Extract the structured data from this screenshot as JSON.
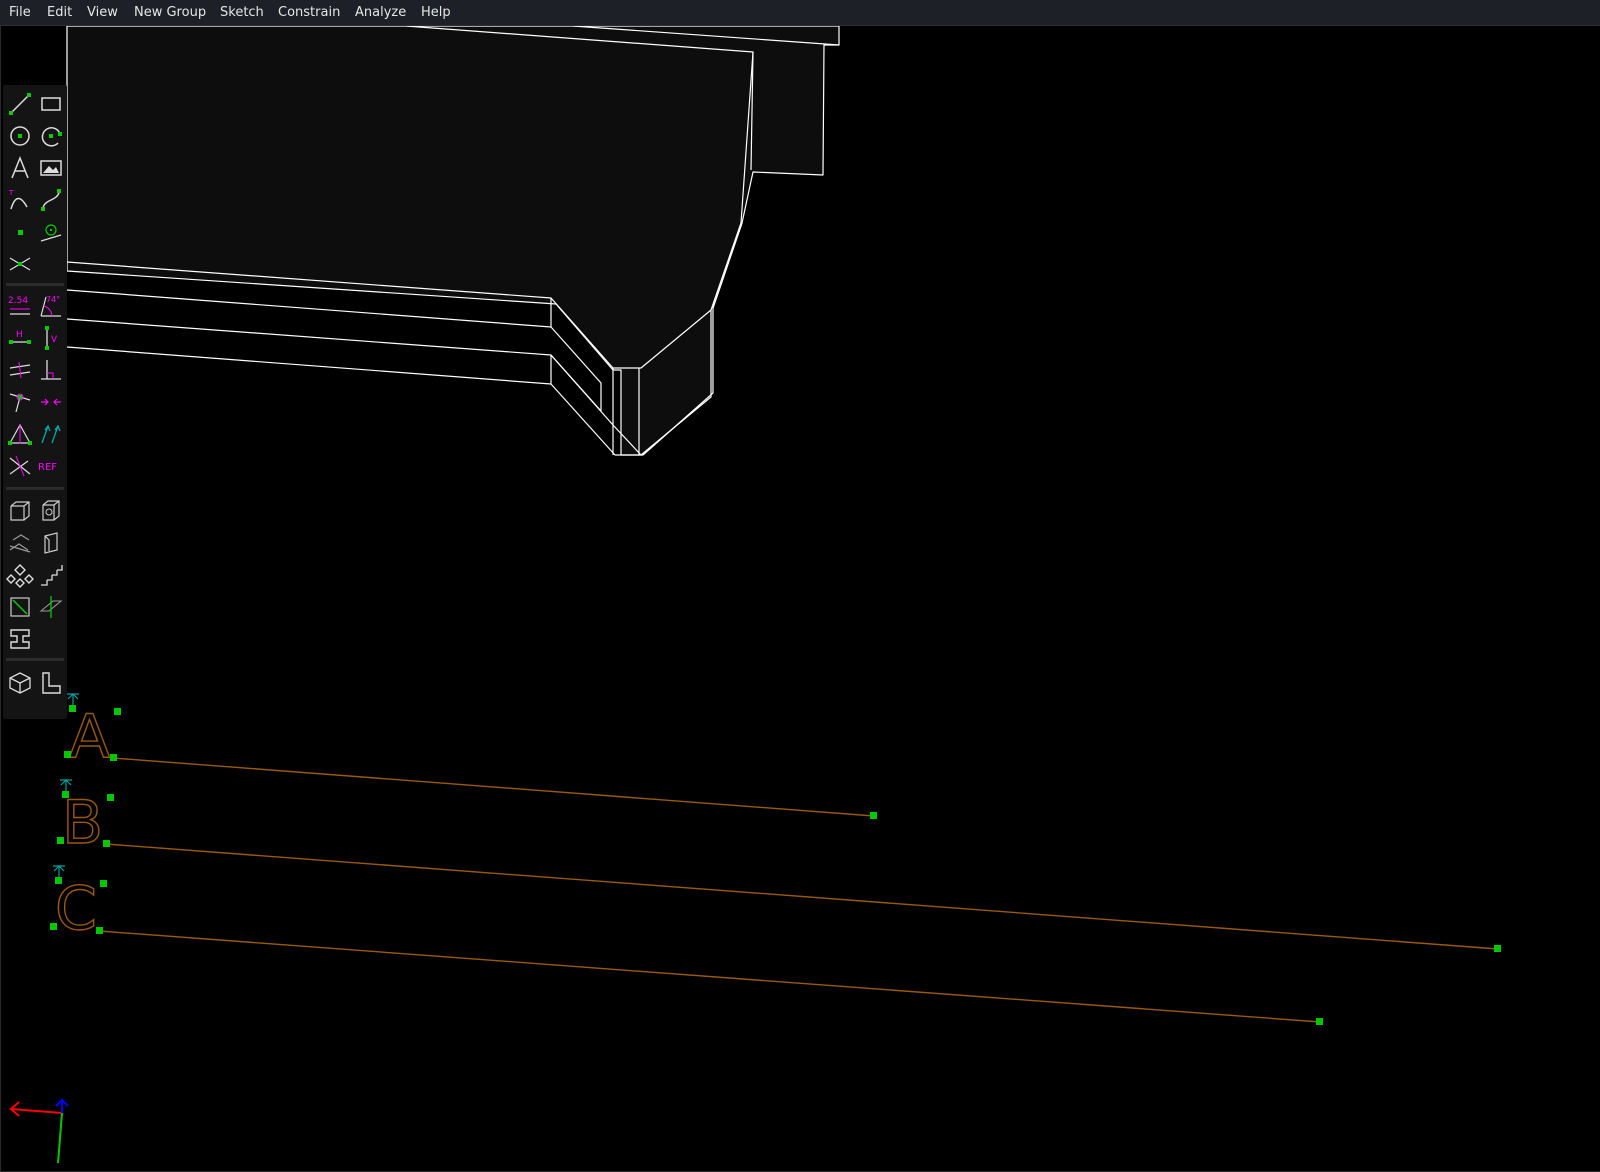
{
  "menu": {
    "file": "File",
    "edit": "Edit",
    "view": "View",
    "new_group": "New Group",
    "sketch": "Sketch",
    "constrain": "Constrain",
    "analyze": "Analyze",
    "help": "Help"
  },
  "toolbar": {
    "sketch_tools": [
      "line-segment-icon",
      "rectangle-icon",
      "circle-icon",
      "arc-icon",
      "text-icon",
      "image-icon",
      "tangent-arc-icon",
      "cubic-spline-icon",
      "datum-point-icon",
      "workplane-icon",
      "split-curves-icon"
    ],
    "constraint_tools": [
      "distance-dimension-icon",
      "angle-dimension-icon",
      "horizontal-icon",
      "vertical-icon",
      "parallel-icon",
      "perpendicular-icon",
      "on-point-icon",
      "equal-length-icon",
      "symmetric-icon",
      "same-orientation-icon",
      "other-supplementary-icon",
      "reference-icon"
    ],
    "constraint_labels": {
      "distance": "2.54",
      "angle": "74°",
      "horizontal": "H",
      "vertical": "V",
      "reference": "REF"
    },
    "group_tools": [
      "sketch-in-3d-icon",
      "sketch-in-workplane-icon",
      "step-translating-icon",
      "step-rotating-icon",
      "extrude-icon",
      "helix-icon",
      "lathe-icon",
      "revolve-icon",
      "link-assembly-icon"
    ],
    "view_tools": [
      "nearest-isometric-icon",
      "nearest-ortho-icon"
    ]
  },
  "sketch": {
    "text_entities": [
      "A",
      "B",
      "C"
    ]
  },
  "colors": {
    "menubar_bg": "#1d2127",
    "menu_text": "#e6e6e6",
    "canvas_bg": "#000000",
    "model_edges": "#ffffff",
    "model_fill": "#0d0d0d",
    "sketch_entity": "#9a5a10",
    "point": "#00c800",
    "constraint": "#ff00ff",
    "normal": "#00a0a0",
    "axis_x": "#ff0000",
    "axis_y": "#00c800",
    "axis_z": "#0000ff"
  }
}
